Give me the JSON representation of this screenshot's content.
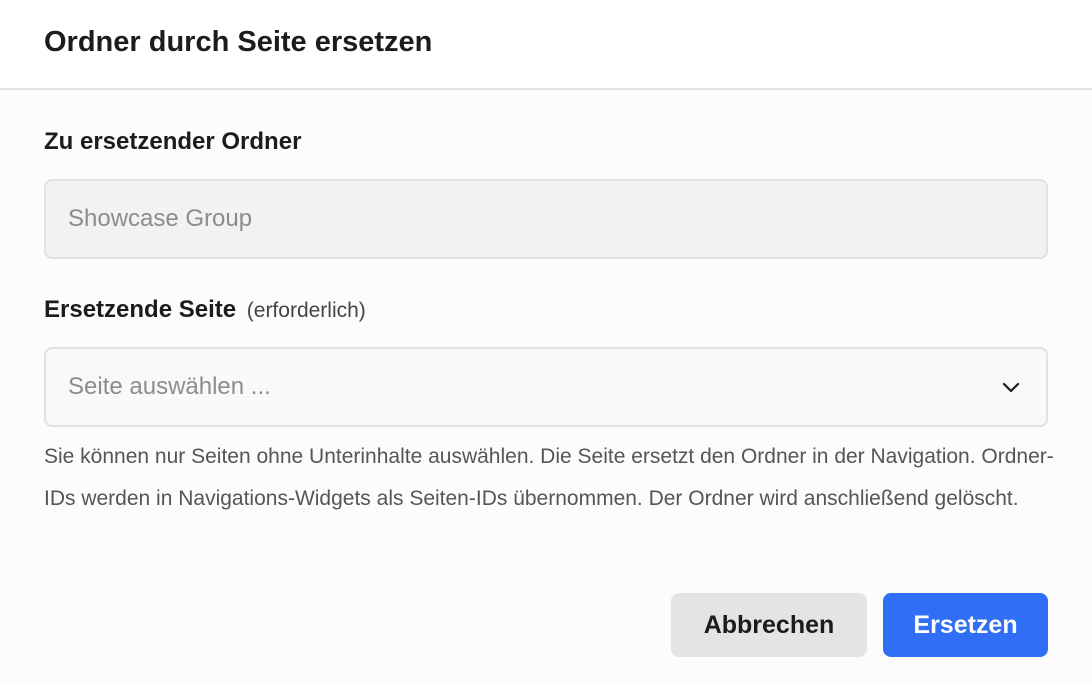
{
  "dialog": {
    "title": "Ordner durch Seite ersetzen"
  },
  "folder_field": {
    "label": "Zu ersetzender Ordner",
    "value": "Showcase Group",
    "readonly": true
  },
  "page_field": {
    "label": "Ersetzende Seite",
    "hint": "(erforderlich)",
    "placeholder": "Seite auswählen ...",
    "icon": "chevron-down-icon"
  },
  "help_text": "Sie können nur Seiten ohne Unterinhalte auswählen. Die Seite ersetzt den Ordner in der Navigation. Ordner-IDs werden in Navigations-Widgets als Seiten-IDs übernommen. Der Ordner wird anschließend gelöscht.",
  "buttons": {
    "cancel_label": "Abbrechen",
    "submit_label": "Ersetzen"
  },
  "colors": {
    "primary": "#2f6ef5",
    "secondary_button": "#e4e4e4",
    "input_disabled_bg": "#f2f2f2",
    "border": "#e2e2e2"
  }
}
